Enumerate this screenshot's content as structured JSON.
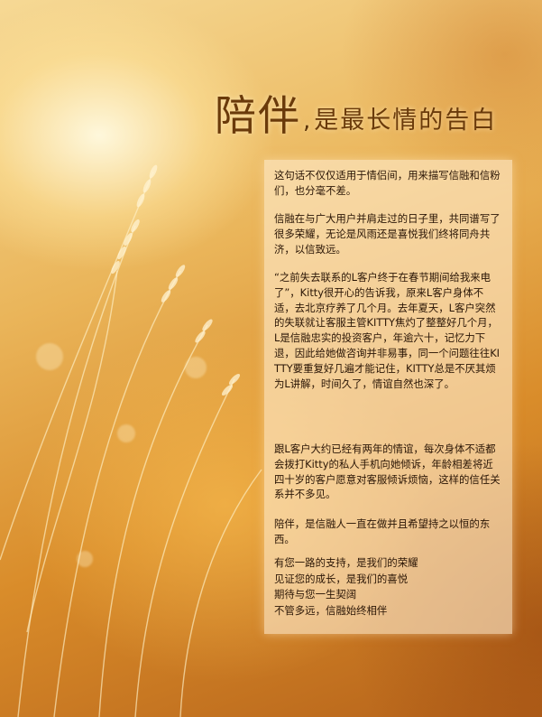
{
  "title": {
    "main": "陪伴",
    "comma": ",",
    "sub": "是最长情的告白"
  },
  "paragraphs": [
    "这句话不仅仅适用于情侣间，用来描写信融和信粉们，也分毫不差。",
    "信融在与广大用户并肩走过的日子里，共同谱写了很多荣耀，无论是风雨还是喜悦我们终将同舟共济，以信致远。",
    "“之前失去联系的L客户终于在春节期间给我来电了”，Kitty很开心的告诉我，原来L客户身体不适，去北京疗养了几个月。去年夏天，L客户突然的失联就让客服主管KITTY焦灼了整整好几个月，L是信融忠实的投资客户，年逾六十，记忆力下退，因此给她做咨询并非易事，同一个问题往往KITTY要重复好几遍才能记住，KITTY总是不厌其烦为L讲解，时间久了，情谊自然也深了。",
    "跟L客户大约已经有两年的情谊，每次身体不适都会拨打Kitty的私人手机向她倾诉，年龄相差将近四十岁的客户愿意对客服倾诉烦恼，这样的信任关系并不多见。",
    "陪伴，是信融人一直在做并且希望持之以恒的东西。"
  ],
  "closing_lines": [
    "有您一路的支持，是我们的荣耀",
    "见证您的成长，是我们的喜悦",
    "期待与您一生契阔",
    "不管多远，信融始终相伴"
  ],
  "colors": {
    "title": "#6a3a0a",
    "panel": "#ffeccd",
    "text": "#2a1505"
  }
}
